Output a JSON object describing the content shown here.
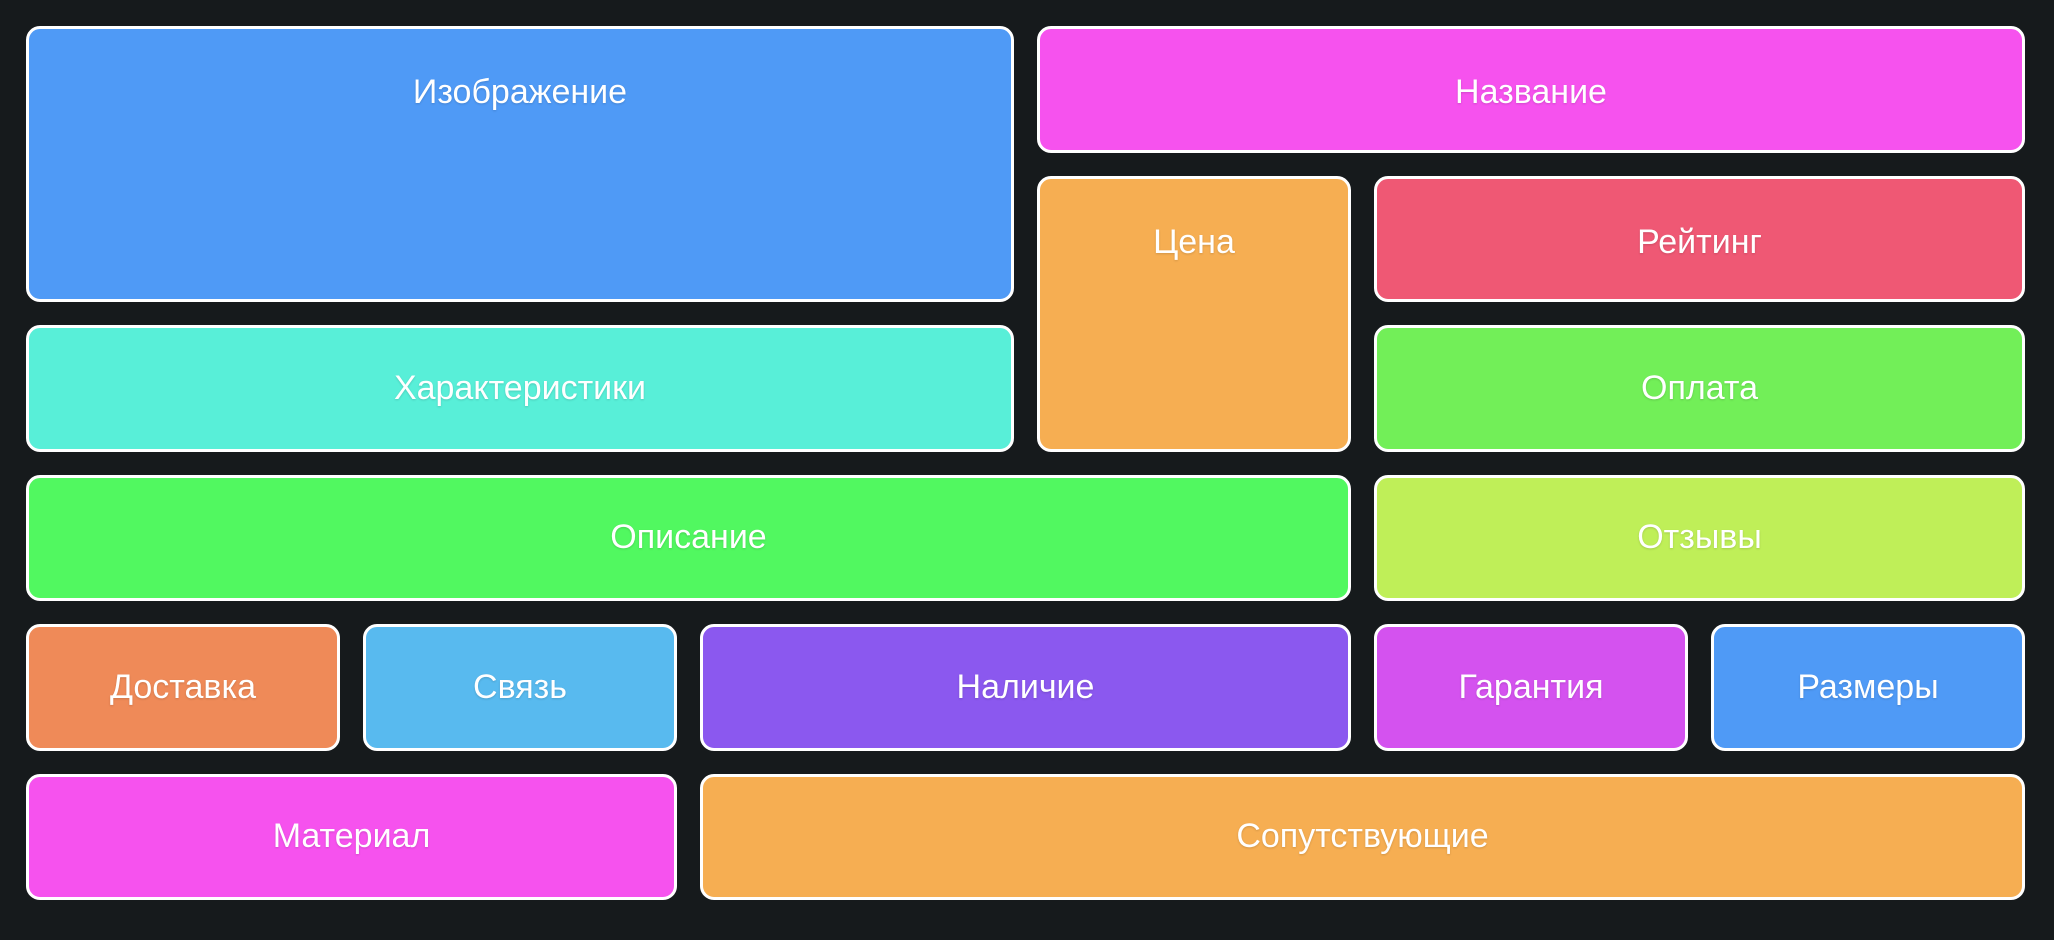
{
  "tiles": [
    {
      "key": "izobrazhenie",
      "label": "Изображение",
      "color": "#4f9af6"
    },
    {
      "key": "nazvanie",
      "label": "Название",
      "color": "#f652ee"
    },
    {
      "key": "tsena",
      "label": "Цена",
      "color": "#f6ae52"
    },
    {
      "key": "reyting",
      "label": "Рейтинг",
      "color": "#ef5874"
    },
    {
      "key": "harakteristiki",
      "label": "Характеристики",
      "color": "#58efd8"
    },
    {
      "key": "oplata",
      "label": "Оплата",
      "color": "#72ef58"
    },
    {
      "key": "opisanie",
      "label": "Описание",
      "color": "#51f860"
    },
    {
      "key": "otzyvy",
      "label": "Отзывы",
      "color": "#bfef58"
    },
    {
      "key": "dostavka",
      "label": "Доставка",
      "color": "#ef8a58"
    },
    {
      "key": "svyaz",
      "label": "Связь",
      "color": "#58baef"
    },
    {
      "key": "nalichie",
      "label": "Наличие",
      "color": "#8b58ef"
    },
    {
      "key": "garantiya",
      "label": "Гарантия",
      "color": "#d452ef"
    },
    {
      "key": "razmery",
      "label": "Размеры",
      "color": "#4f9af6"
    },
    {
      "key": "material",
      "label": "Материал",
      "color": "#f652ee"
    },
    {
      "key": "soputstvuyushchie",
      "label": "Сопутствующие",
      "color": "#f6ae52"
    }
  ]
}
